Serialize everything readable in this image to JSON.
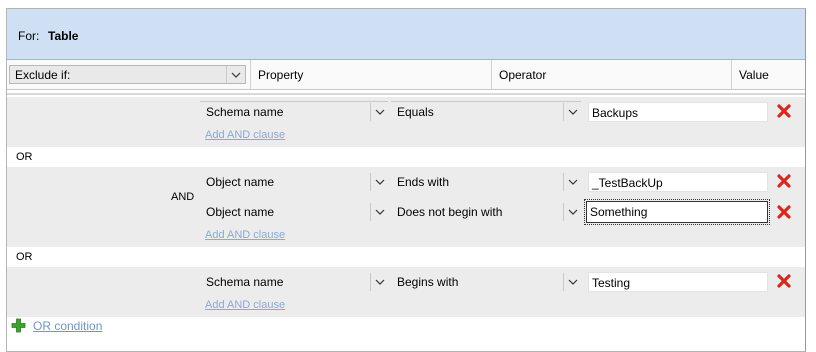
{
  "for_bar": {
    "label": "For:",
    "value": "Table"
  },
  "header": {
    "mode_select": "Exclude if:",
    "columns": [
      "Property",
      "Operator",
      "Value"
    ]
  },
  "groups": [
    {
      "and_label": "",
      "clauses": [
        {
          "property": "Schema name",
          "operator": "Equals",
          "value": "Backups"
        }
      ],
      "add_and": "Add AND clause"
    },
    {
      "and_label": "AND",
      "clauses": [
        {
          "property": "Object name",
          "operator": "Ends with",
          "value": "_TestBackUp"
        },
        {
          "property": "Object name",
          "operator": "Does not begin with",
          "value": "Something"
        }
      ],
      "add_and": "Add AND clause"
    },
    {
      "and_label": "",
      "clauses": [
        {
          "property": "Schema name",
          "operator": "Begins with",
          "value": "Testing"
        }
      ],
      "add_and": "Add AND clause"
    }
  ],
  "or_separators": [
    "OR",
    "OR"
  ],
  "footer": {
    "or_condition": "OR condition"
  },
  "colors": {
    "for_bar_bg": "#cfe0f5",
    "delete_red": "#d9271c",
    "add_green": "#3aa52c",
    "link": "#6f95c9"
  }
}
